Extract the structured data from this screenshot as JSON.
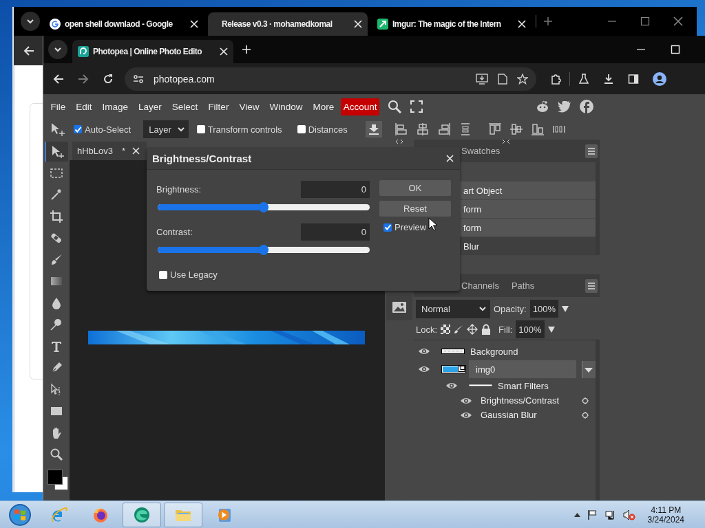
{
  "back_window": {
    "tabs": [
      {
        "title": "open shell downlaod - Google",
        "kind": "google",
        "selected": false
      },
      {
        "title": "Release v0.3 · mohamedkomal",
        "kind": "plain",
        "selected": true
      },
      {
        "title": "Imgur: The magic of the Intern",
        "kind": "imgur",
        "selected": false
      }
    ]
  },
  "browser": {
    "tab": {
      "title": "Photopea | Online Photo Edito",
      "selected": true
    },
    "address": "photopea.com"
  },
  "photopea": {
    "menu": [
      "File",
      "Edit",
      "Image",
      "Layer",
      "Select",
      "Filter",
      "View",
      "Window",
      "More"
    ],
    "account_button": "Account",
    "options": {
      "auto_select": {
        "label": "Auto-Select",
        "checked": true
      },
      "target": "Layer",
      "transform_controls": {
        "label": "Transform controls",
        "checked": false
      },
      "distances": {
        "label": "Distances",
        "checked": false
      }
    },
    "tools": [
      {
        "kind": "move",
        "selected": true
      },
      {
        "kind": "marquee",
        "selected": false
      },
      {
        "kind": "wand",
        "selected": false
      },
      {
        "kind": "crop",
        "selected": false
      },
      {
        "kind": "heal",
        "selected": false
      },
      {
        "kind": "brush",
        "selected": false
      },
      {
        "kind": "gradient",
        "selected": false
      },
      {
        "kind": "drop",
        "selected": false
      },
      {
        "kind": "dodge",
        "selected": false
      },
      {
        "kind": "type",
        "selected": false
      },
      {
        "kind": "pen",
        "selected": false
      },
      {
        "kind": "pathselect",
        "selected": false
      },
      {
        "kind": "rect",
        "selected": false
      },
      {
        "kind": "hand",
        "selected": false
      },
      {
        "kind": "zoom",
        "selected": false
      }
    ],
    "document_tab": {
      "title": "hHbLov3",
      "modified": "*"
    },
    "history": {
      "tab": "Swatches",
      "rows": [
        {
          "label": "art Object",
          "selected": false
        },
        {
          "label": "form",
          "selected": false
        },
        {
          "label": "form",
          "selected": false
        },
        {
          "label": "Blur",
          "selected": true
        }
      ]
    },
    "layers_panel": {
      "tabs": [
        {
          "label": "Channels",
          "selected": false
        },
        {
          "label": "Paths",
          "selected": false
        }
      ],
      "blend_mode": "Normal",
      "opacity_label": "Opacity:",
      "opacity": "100%",
      "lock_label": "Lock:",
      "fill_label": "Fill:",
      "fill": "100%",
      "layers": [
        {
          "name": "Background",
          "visible": true,
          "selected": false
        },
        {
          "name": "img0",
          "visible": true,
          "selected": true,
          "children": [
            {
              "name": "Smart Filters",
              "visible": true,
              "children": [
                {
                  "name": "Brightness/Contrast",
                  "visible": true
                },
                {
                  "name": "Gaussian Blur",
                  "visible": true
                }
              ]
            }
          ]
        }
      ]
    },
    "dialog": {
      "title": "Brightness/Contrast",
      "sliders": [
        {
          "label": "Brightness:",
          "value": "0",
          "level": 0.5
        },
        {
          "label": "Contrast:",
          "value": "0",
          "level": 0.5
        }
      ],
      "use_legacy": {
        "label": "Use Legacy",
        "checked": false
      },
      "buttons": [
        "OK",
        "Reset"
      ],
      "preview": {
        "label": "Preview",
        "checked": true
      }
    }
  },
  "taskbar": {
    "apps": [
      {
        "kind": "ie",
        "selected": false
      },
      {
        "kind": "firefox",
        "selected": false
      },
      {
        "kind": "edge",
        "selected": true
      },
      {
        "kind": "explorer",
        "selected": true
      },
      {
        "kind": "media",
        "selected": false
      }
    ],
    "clock": {
      "time": "4:11 PM",
      "date": "3/24/2024"
    }
  }
}
